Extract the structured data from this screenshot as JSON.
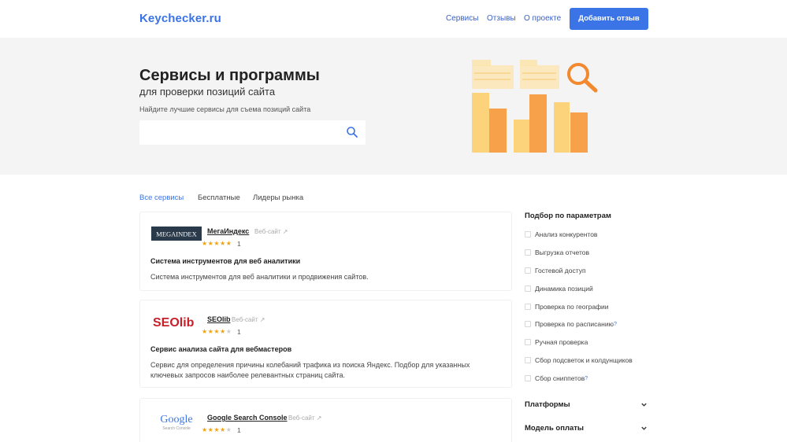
{
  "header": {
    "logo": "Keychecker.ru",
    "nav": [
      "Сервисы",
      "Отзывы",
      "О проекте"
    ],
    "add_button": "Добавить отзыв"
  },
  "hero": {
    "title": "Сервисы и программы",
    "subtitle": "для проверки позиций сайта",
    "hint": "Найдите лучшие сервисы для съема позиций сайта",
    "search_placeholder": "",
    "search_icon": "search-icon"
  },
  "tabs": [
    "Все сервисы",
    "Бесплатные",
    "Лидеры рынка"
  ],
  "cards": [
    {
      "logo_text": "MEGAINDEX",
      "name": "МегаИндекс",
      "web": "Веб-сайт",
      "rating": 5,
      "reviews": "1",
      "title": "Система инструментов для веб аналитики",
      "desc": "Система инструментов для веб аналитики и продвижения сайтов."
    },
    {
      "logo_text": "SEOlib",
      "name": "SEOlib",
      "web": "Веб-сайт",
      "rating": 4,
      "reviews": "1",
      "title": "Сервис анализа сайта для вебмастеров",
      "desc": "Сервис для определения причины колебаний трафика из поиска Яндекс. Подбор для указанных ключевых запросов наиболее релевантных страниц сайта."
    },
    {
      "logo_text": "Google",
      "logo_sub": "Search Console",
      "name": "Google Search Console",
      "web": "Веб-сайт",
      "rating": 4,
      "reviews": "1"
    }
  ],
  "sidebar": {
    "title": "Подбор по параметрам",
    "options": [
      "Анализ конкурентов",
      "Выгрузка отчетов",
      "Гостевой доступ",
      "Динамика позиций",
      "Проверка по географии",
      "Проверка по расписанию",
      "Ручная проверка",
      "Сбор подсветок и колдунщиков",
      "Сбор сниппетов"
    ],
    "help_mark": "?",
    "accordions": [
      "Платформы",
      "Модель оплаты"
    ]
  },
  "colors": {
    "accent": "#3b74e6",
    "star": "#f2a20e",
    "bar_orange": "#f7a24a",
    "bar_yellow": "#fcd27b"
  }
}
